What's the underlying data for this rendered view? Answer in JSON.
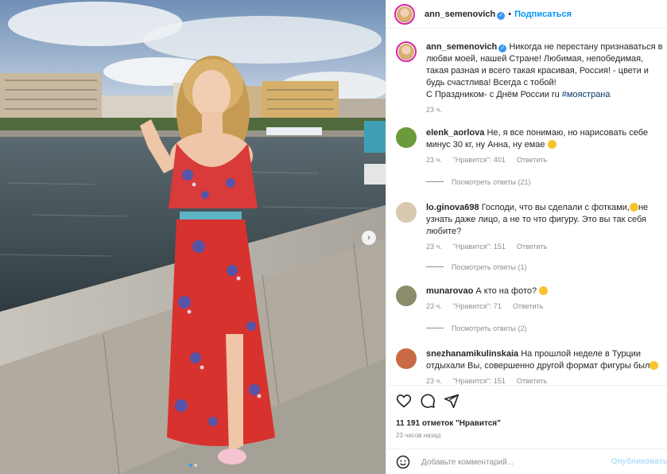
{
  "post": {
    "username": "ann_semenovich",
    "follow_label": "Подписаться",
    "separator": "•",
    "caption_username": "ann_semenovich",
    "caption_text": "Никогда не перестану признаваться в любви моей, нашей Стране! Любимая, непобедимая, такая разная и всего такая красивая, Россия! - цвети и будь счастлива! Всегда с тобой!",
    "caption_line2": "С Праздником- с Днём России ru",
    "caption_hashtag": "#моястрана",
    "caption_time": "23 ч."
  },
  "comments": [
    {
      "username": "elenk_aorlova",
      "text": "Не, я все понимаю, но нарисовать себе минус 30 кг, ну Анна, ну емае",
      "time": "23 ч.",
      "likes": "\"Нравится\": 401",
      "reply": "Ответить",
      "replies": "Посмотреть ответы (21)"
    },
    {
      "username": "lo.ginova698",
      "text": "Господи, что вы сделали с фотками,",
      "text_after": "не узнать даже лицо, а не то что фигуру. Это вы так себя любите?",
      "time": "23 ч.",
      "likes": "\"Нравится\": 151",
      "reply": "Ответить",
      "replies": "Посмотреть ответы (1)"
    },
    {
      "username": "munarovao",
      "text": "А кто на фото?",
      "time": "23 ч.",
      "likes": "\"Нравится\": 71",
      "reply": "Ответить",
      "replies": "Посмотреть ответы (2)"
    },
    {
      "username": "snezhanamikulinskaia",
      "text": "На прошлой неделе в Турции отдыхали Вы, совершенно другой формат фигуры был",
      "time": "23 ч.",
      "likes": "\"Нравится\": 151",
      "reply": "Ответить"
    }
  ],
  "actions": {
    "likes": "11 191 отметок \"Нравится\"",
    "ago": "23 часов назад"
  },
  "add_comment": {
    "placeholder": "Добавьте комментарий...",
    "publish": "Опубликовать"
  },
  "icons": [
    "heart-icon",
    "comment-icon",
    "share-icon",
    "emoji-icon",
    "verified-icon",
    "next-icon"
  ],
  "colors": {
    "link": "#0095f6",
    "hashtag": "#00376b",
    "muted": "#8e8e8e"
  },
  "carousel": {
    "slides": 2,
    "active": 1
  }
}
